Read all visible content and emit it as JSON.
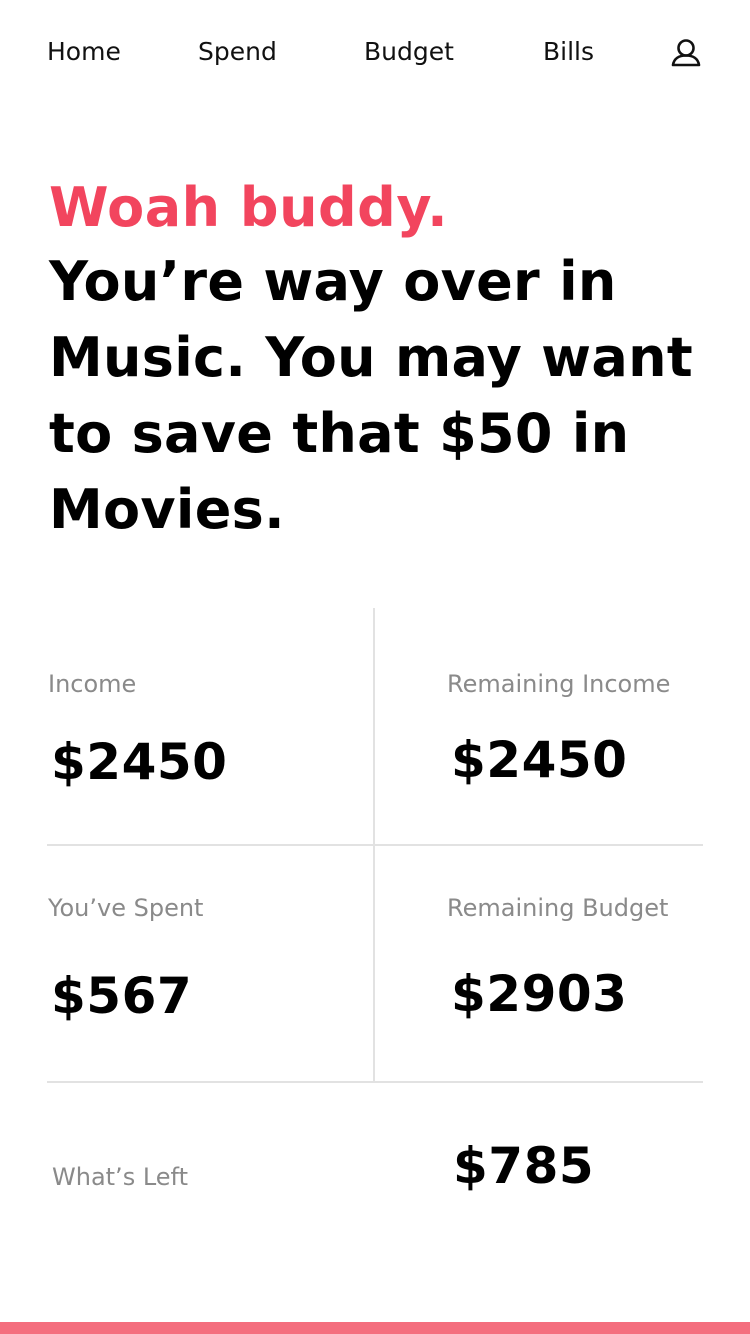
{
  "colors": {
    "accent": "#F2455E",
    "label_gray": "#8A8A8A",
    "divider": "#E2E2E2",
    "bottom_bar": "#F46E7E"
  },
  "nav": {
    "items": [
      {
        "label": "Home"
      },
      {
        "label": "Spend"
      },
      {
        "label": "Budget"
      },
      {
        "label": "Bills"
      }
    ],
    "profile_icon": "user-icon"
  },
  "alert": {
    "title": "Woah buddy.",
    "message": "You’re way over in Music. You may want to save that $50 in Movies."
  },
  "stats": {
    "income": {
      "label": "Income",
      "value": "$2450"
    },
    "remaining_income": {
      "label": "Remaining Income",
      "value": "$2450"
    },
    "spent": {
      "label": "You’ve Spent",
      "value": "$567"
    },
    "remaining_budget": {
      "label": "Remaining Budget",
      "value": "$2903"
    },
    "whats_left": {
      "label": "What’s Left",
      "value": "$785"
    }
  }
}
